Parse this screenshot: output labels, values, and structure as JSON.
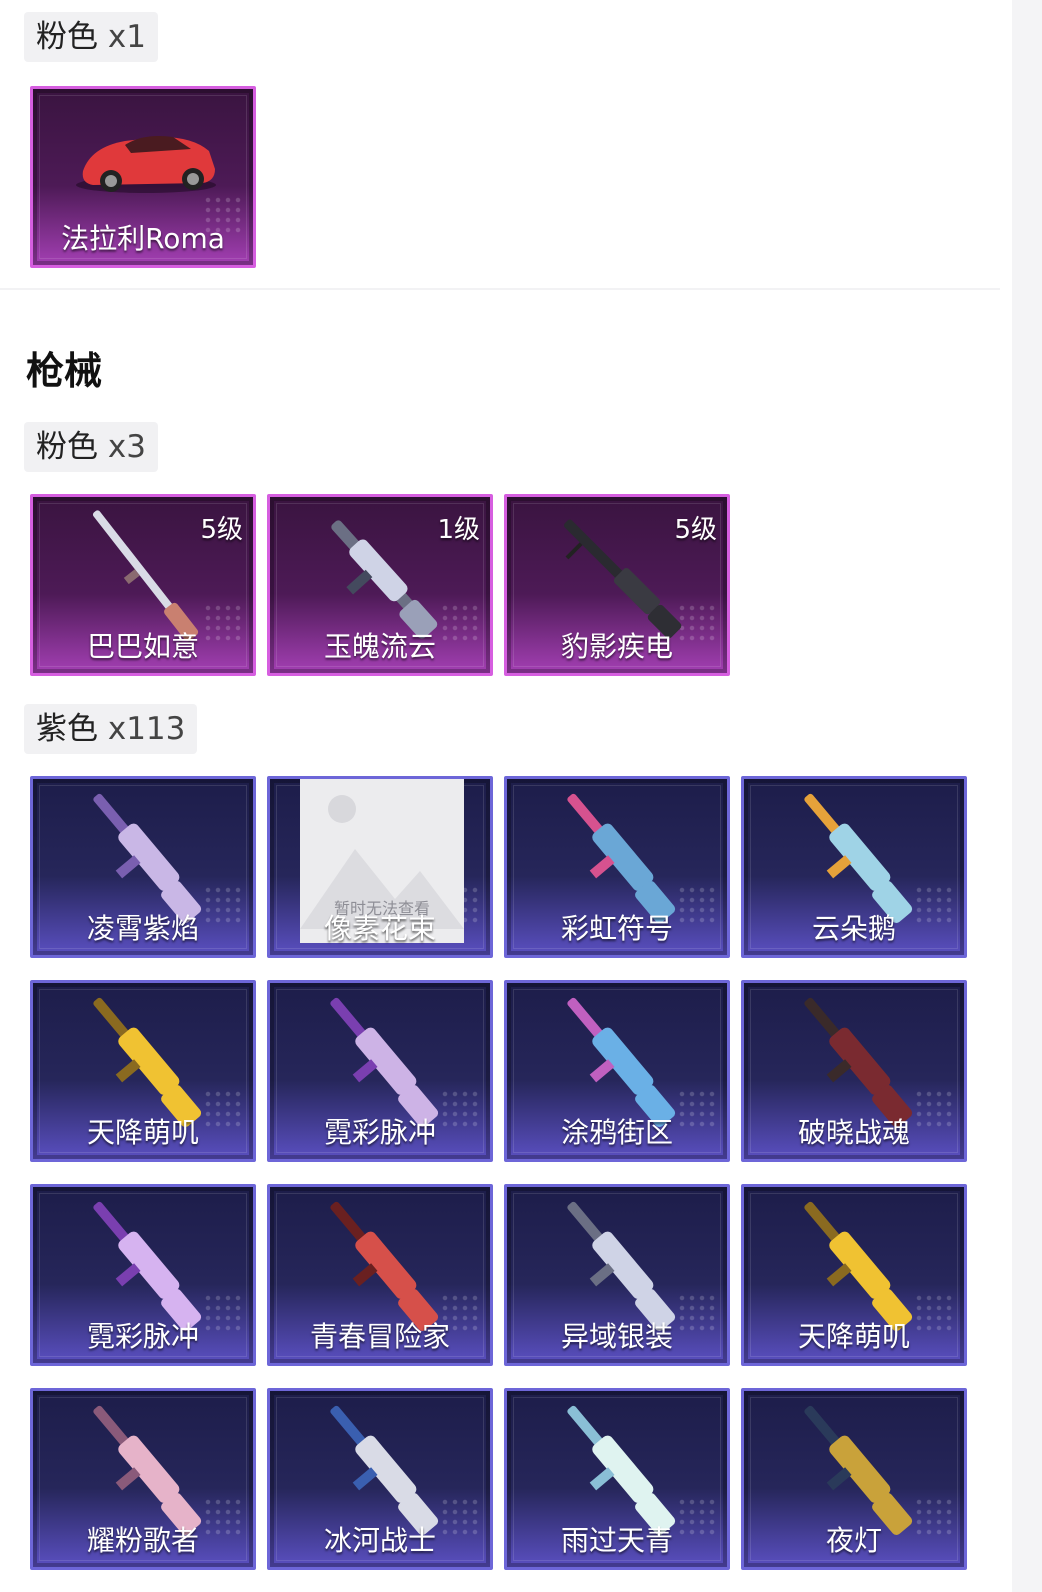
{
  "vehicles": {
    "pink_group": {
      "label": "粉色",
      "count": "x1"
    },
    "items": [
      {
        "name": "法拉利Roma",
        "icon": "red-sports-car-icon"
      }
    ]
  },
  "guns": {
    "title": "枪械",
    "pink_group": {
      "label": "粉色",
      "count": "x3",
      "items": [
        {
          "name": "巴巴如意",
          "level": "5级",
          "icon": "sniper-rifle-icon"
        },
        {
          "name": "玉魄流云",
          "level": "1级",
          "icon": "smg-icon"
        },
        {
          "name": "豹影疾电",
          "level": "5级",
          "icon": "machine-gun-icon"
        }
      ]
    },
    "purple_group": {
      "label": "紫色",
      "count": "x113",
      "items": [
        {
          "name": "凌霄紫焰",
          "icon": "rifle-icon"
        },
        {
          "name": "像素花束",
          "icon": "image-placeholder-icon",
          "placeholder_text": "暂时无法查看"
        },
        {
          "name": "彩虹符号",
          "icon": "assault-rifle-icon"
        },
        {
          "name": "云朵鹅",
          "icon": "assault-rifle-icon"
        },
        {
          "name": "天降萌叽",
          "icon": "assault-rifle-icon"
        },
        {
          "name": "霓彩脉冲",
          "icon": "assault-rifle-icon"
        },
        {
          "name": "涂鸦街区",
          "icon": "assault-rifle-icon"
        },
        {
          "name": "破晓战魂",
          "icon": "assault-rifle-icon"
        },
        {
          "name": "霓彩脉冲",
          "icon": "bullpup-rifle-icon"
        },
        {
          "name": "青春冒险家",
          "icon": "bullpup-rifle-icon"
        },
        {
          "name": "异域银装",
          "icon": "bullpup-rifle-icon"
        },
        {
          "name": "天降萌叽",
          "icon": "bullpup-rifle-icon"
        },
        {
          "name": "耀粉歌者",
          "icon": "bullpup-rifle-icon"
        },
        {
          "name": "冰河战士",
          "icon": "m4-rifle-icon"
        },
        {
          "name": "雨过天青",
          "icon": "m4-rifle-icon"
        },
        {
          "name": "夜灯",
          "icon": "m4-rifle-icon"
        }
      ]
    }
  },
  "colors": {
    "pink_border": "#d65ee0",
    "purple_border": "#6d66d8"
  }
}
